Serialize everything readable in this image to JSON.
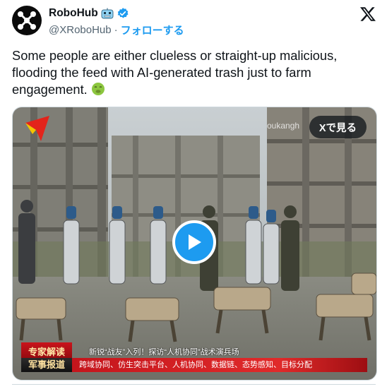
{
  "author": {
    "name": "RoboHub",
    "name_emoji_icon": "robot-face-icon",
    "verified": true,
    "handle": "@XRoboHub",
    "separator": "·",
    "follow_label": "フォローする"
  },
  "tweet": {
    "text": "Some people are either clueless or straight-up malicious, flooding the feed with AI-generated trash just to farm engagement.",
    "trailing_emoji_icon": "nauseated-face-icon"
  },
  "media": {
    "watch_on_x_label": "Xで見る",
    "watermark": "oukangh",
    "overlay_tag_1": "专家解读",
    "overlay_title": "新锐“战友”入列！探访“人机协同”战术演兵场",
    "overlay_tag_2": "军事报道",
    "overlay_ticker": "跨域协同、仿生突击平台、人机协同、数据链、态势感知、目标分配",
    "play_icon": "play-icon"
  },
  "colors": {
    "accent": "#1d9bf0",
    "verified": "#1d9bf0",
    "text_primary": "#0f1419",
    "text_secondary": "#536471"
  }
}
